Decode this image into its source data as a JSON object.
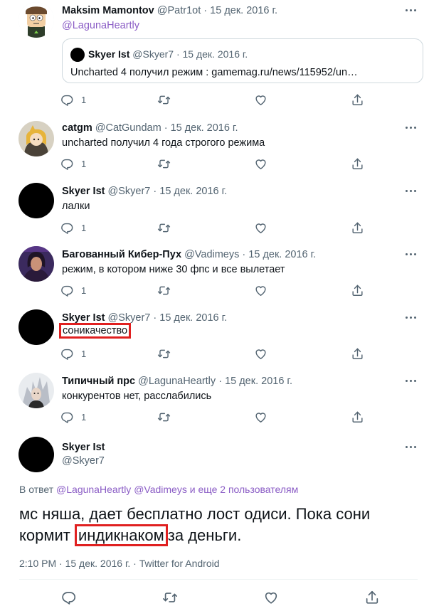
{
  "tweets": [
    {
      "name": "Maksim Mamontov",
      "handle": "@Patr1ot",
      "dot": "·",
      "date": "15 дек. 2016 г.",
      "text": "@LagunaHeartly",
      "quote": {
        "name": "Skyer Ist",
        "handle": "@Skyer7",
        "dot": "·",
        "date": "15 дек. 2016 г.",
        "text": "Uncharted 4 получил режим : gamemag.ru/news/115952/un…"
      },
      "reply_count": "1"
    },
    {
      "name": "catgm",
      "handle": "@CatGundam",
      "dot": "·",
      "date": "15 дек. 2016 г.",
      "text": "uncharted получил 4 года строгого режима",
      "reply_count": "1"
    },
    {
      "name": "Skyer Ist",
      "handle": "@Skyer7",
      "dot": "·",
      "date": "15 дек. 2016 г.",
      "text": "лалки",
      "reply_count": "1"
    },
    {
      "name": "Багованный Кибер-Пух",
      "handle": "@Vadimeys",
      "dot": "·",
      "date": "15 дек. 2016 г.",
      "text": "режим, в котором  ниже 30 фпс и все вылетает",
      "reply_count": "1"
    },
    {
      "name": "Skyer Ist",
      "handle": "@Skyer7",
      "dot": "·",
      "date": "15 дек. 2016 г.",
      "text": "соникачество",
      "reply_count": "1"
    },
    {
      "name": "Типичный прс",
      "handle": "@LagunaHeartly",
      "dot": "·",
      "date": "15 дек. 2016 г.",
      "text": "конкурентов нет, расслабились",
      "reply_count": "1"
    }
  ],
  "main_tweet": {
    "name": "Skyer Ist",
    "handle": "@Skyer7",
    "reply_prefix": "В ответ",
    "reply_mentions": "@LagunaHeartly @Vadimeys",
    "reply_suffix": "и еще 2 пользователям",
    "text_line1": "мс няша, дает бесплатно лост одиси. Пока сони",
    "text_word_before": "кормит",
    "text_highlight": "индикнаком",
    "text_word_after": "за  деньги.",
    "time": "2:10 PM",
    "dot": "·",
    "date": "15 дек. 2016 г.",
    "source": "Twitter for Android"
  },
  "icons": {
    "reply": "reply-icon",
    "retweet": "retweet-icon",
    "like": "heart-icon",
    "share": "share-icon",
    "more": "more-icon"
  },
  "colors": {
    "text": "#0f1419",
    "secondary": "#536471",
    "mention": "#8a5cc5",
    "highlight_box": "#e02020",
    "border": "#cfd9de"
  }
}
